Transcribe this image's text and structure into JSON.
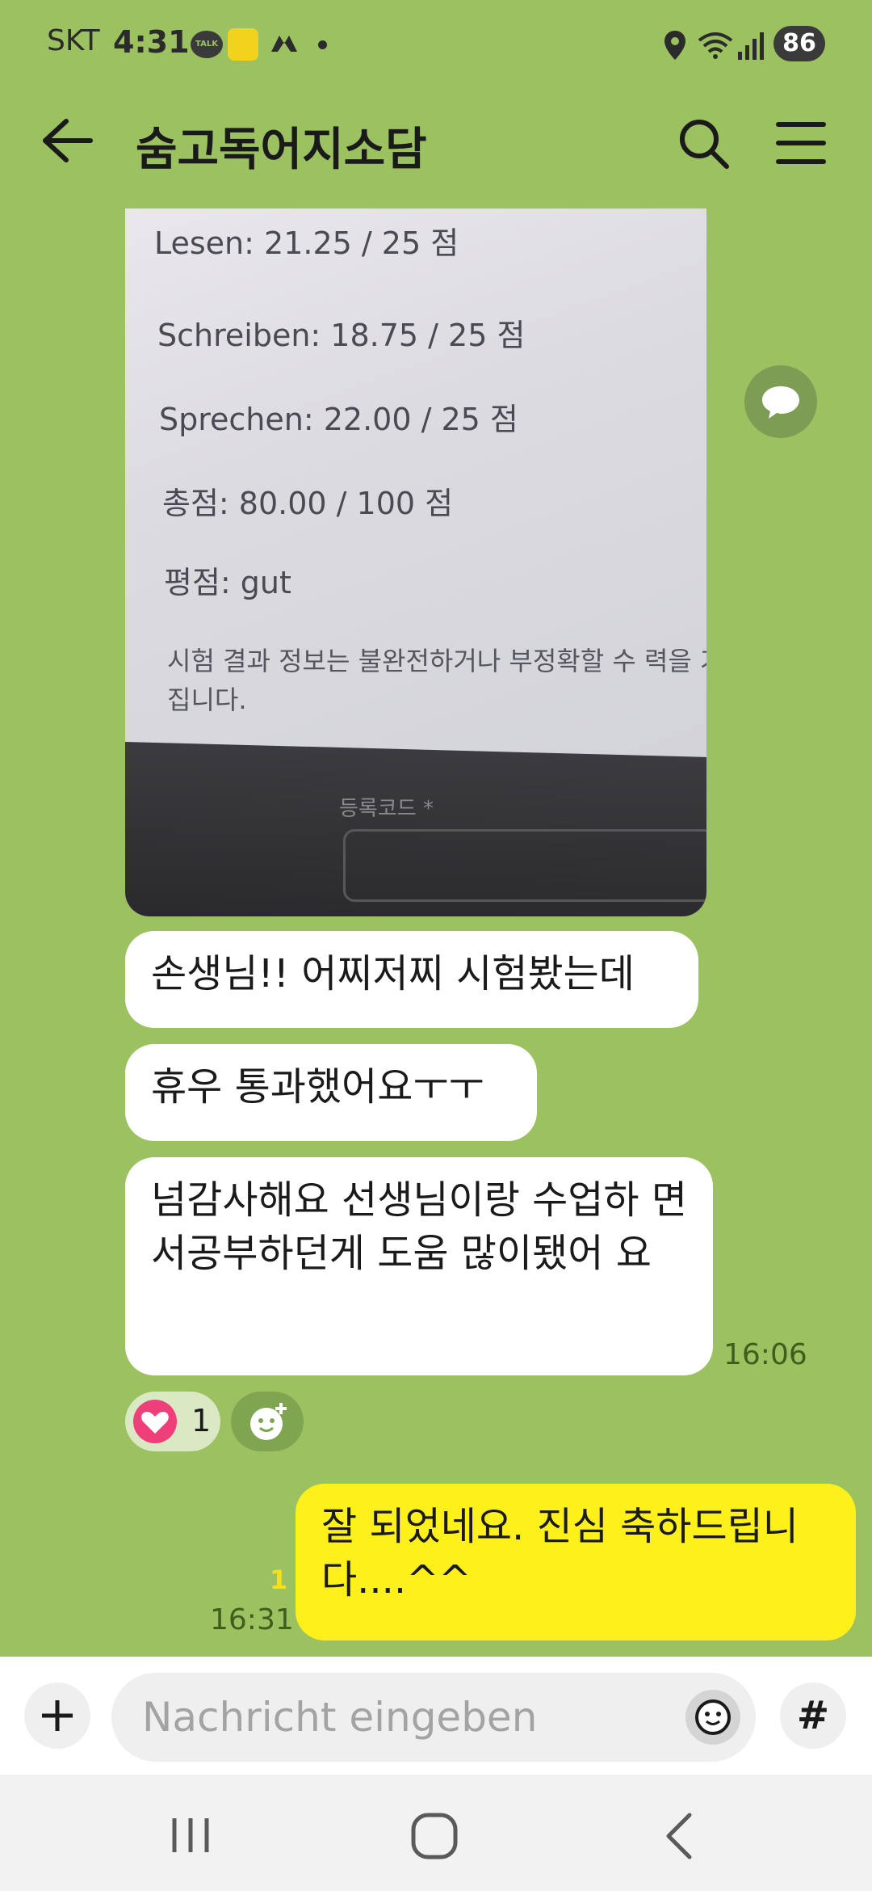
{
  "status_bar": {
    "carrier": "SKT",
    "time": "4:31",
    "talk_badge": "TALK",
    "battery": "86"
  },
  "header": {
    "title": "숨고독어지소담"
  },
  "photo": {
    "lines": [
      "Lesen:  21.25 / 25 점",
      "Schreiben:  18.75 / 25 점",
      "Sprechen:  22.00 / 25 점",
      "총점:  80.00 / 100 점",
      "평점:  gut"
    ],
    "note": "시험 결과 정보는 불완전하거나 부정확할 수 력을 가집니다.",
    "field_label": "등록코드 *"
  },
  "messages": [
    {
      "text": "손생님!!  어찌저찌 시험봤는데"
    },
    {
      "text": "휴우 통과했어요ㅜㅜ"
    },
    {
      "text": "넘감사해요 선생님이랑 수업하 면서공부하던게  도움 많이됐어 요",
      "time": "16:06"
    },
    {
      "text": "잘 되었네요. 진심 축하드립니 다....^^",
      "time": "16:31",
      "unread": "1"
    }
  ],
  "reactions": {
    "heart_count": "1"
  },
  "input": {
    "placeholder": "Nachricht eingeben",
    "hash": "#"
  },
  "colors": {
    "chat_background": "#9bc161",
    "my_bubble": "#fef01b",
    "other_bubble": "#ffffff",
    "heart": "#ef3f7a"
  }
}
